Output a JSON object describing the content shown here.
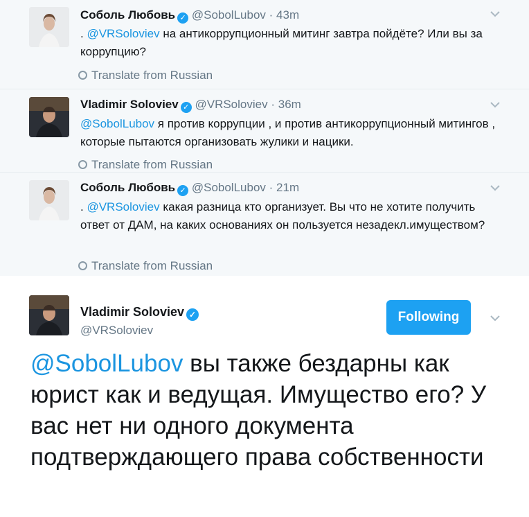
{
  "tweets": [
    {
      "name": "Соболь Любовь",
      "handle": "@SobolLubov",
      "sep": "·",
      "time": "43m",
      "mention": "@VRSoloviev",
      "prefix": ". ",
      "text": " на антикоррупционный митинг завтра пойдёте? Или вы за коррупцию?",
      "translate": "Translate from Russian"
    },
    {
      "name": "Vladimir Soloviev",
      "handle": "@VRSoloviev",
      "sep": "·",
      "time": "36m",
      "mention": "@SobolLubov",
      "prefix": "",
      "text": " я против коррупции , и против антикоррупционный митингов , которые пытаются организовать жулики и нацики.",
      "translate": "Translate from Russian"
    },
    {
      "name": "Соболь Любовь",
      "handle": "@SobolLubov",
      "sep": "·",
      "time": "21m",
      "mention": "@VRSoloviev",
      "prefix": ". ",
      "text": " какая разница кто организует. Вы что не хотите получить ответ от ДАМ, на каких основаниях он пользуется незадекл.имуществом?",
      "translate": "Translate from Russian"
    }
  ],
  "main": {
    "name": "Vladimir Soloviev",
    "handle": "@VRSoloviev",
    "follow_label": "Following",
    "mention": "@SobolLubov",
    "text": " вы также бездарны как юрист как и ведущая. Имущество его? У вас нет ни одного документа подтверждающего права собственности"
  },
  "colors": {
    "accent": "#1da1f2",
    "link": "#1b95e0",
    "muted": "#657786",
    "thread_bg": "#f5f8fa"
  },
  "icons": {
    "verified": "verified-badge-icon",
    "translate": "globe-icon",
    "menu": "chevron-down-icon"
  }
}
